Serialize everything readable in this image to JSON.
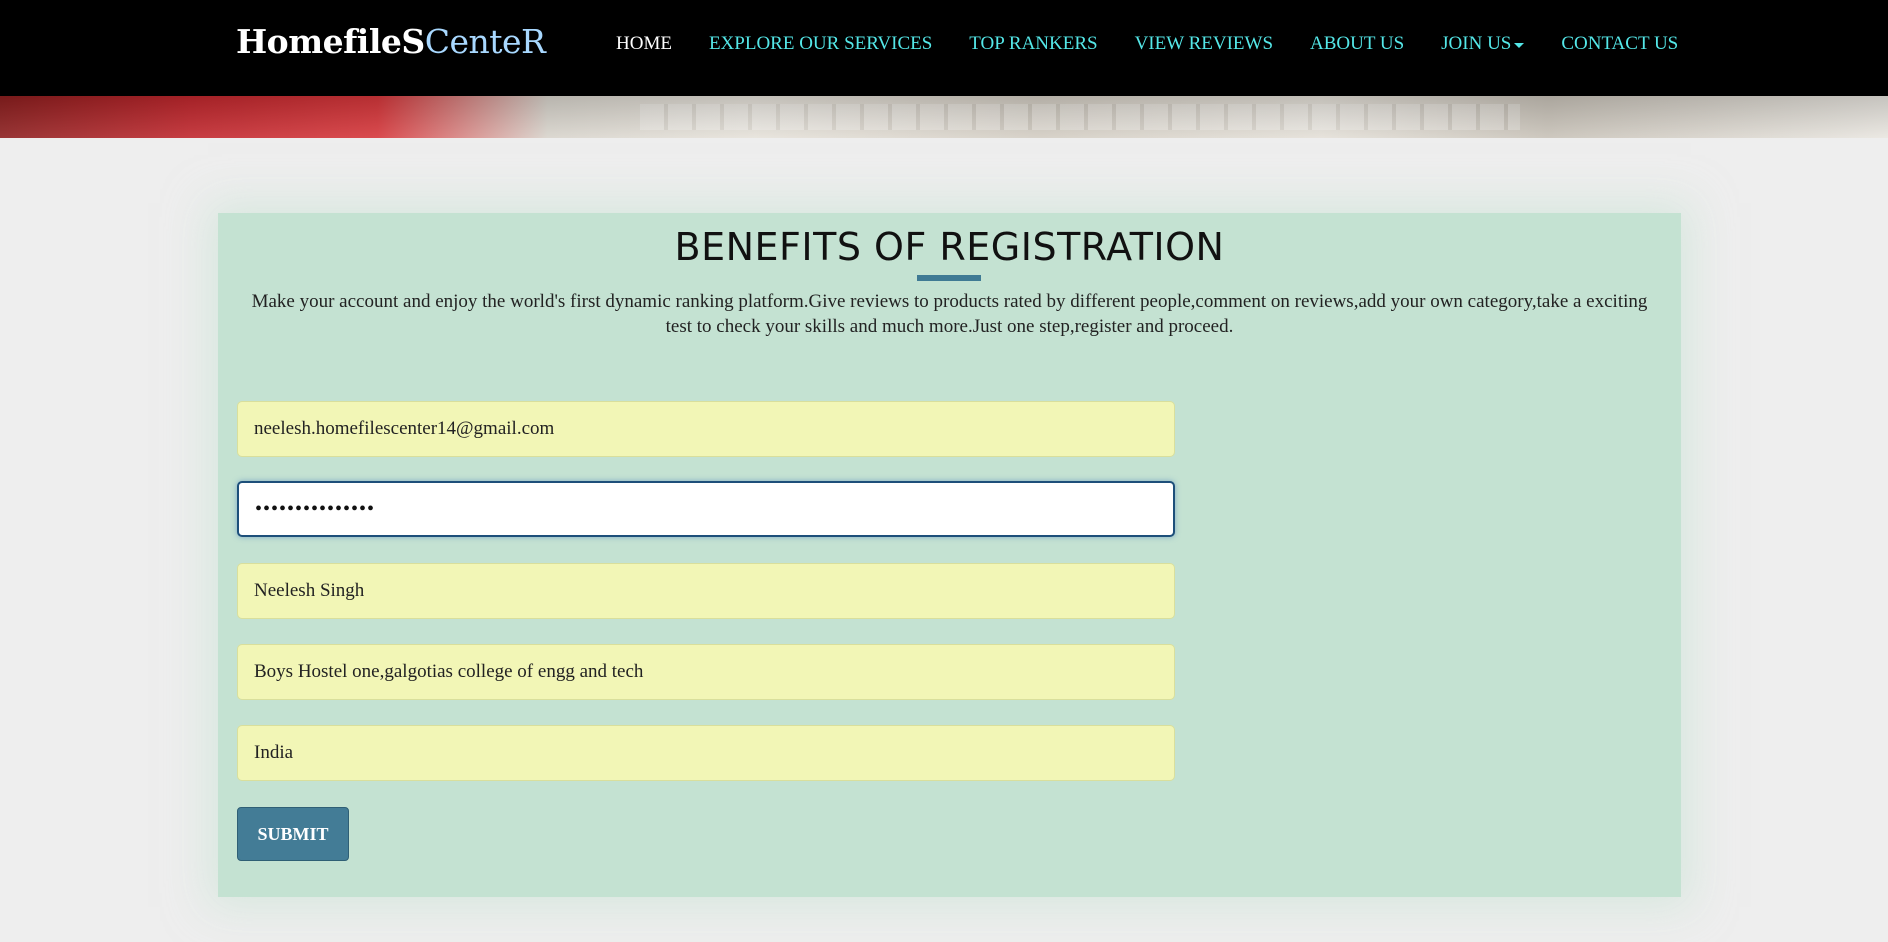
{
  "brand": {
    "part1": "HomefileS",
    "part2": "CenteR"
  },
  "nav": {
    "items": [
      {
        "label": "HOME"
      },
      {
        "label": "EXPLORE OUR SERVICES"
      },
      {
        "label": "TOP RANKERS"
      },
      {
        "label": "VIEW REVIEWS"
      },
      {
        "label": "ABOUT US"
      },
      {
        "label": "JOIN US"
      },
      {
        "label": "CONTACT US"
      }
    ]
  },
  "panel": {
    "title": "BENEFITS OF REGISTRATION",
    "description": "Make your account and enjoy the world's first dynamic ranking platform.Give reviews to products rated by different people,comment on reviews,add your own category,take a exciting test to check your skills and much more.Just one step,register and proceed."
  },
  "form": {
    "email": "neelesh.homefilescenter14@gmail.com",
    "password_masked": "•••••••••••••••",
    "name": "Neelesh Singh",
    "address": "Boys Hostel one,galgotias college of engg and tech",
    "country": "India",
    "submit_label": "SUBMIT"
  },
  "colors": {
    "nav_bg": "#000000",
    "nav_link": "#54e7e8",
    "panel_bg": "#c4e2d2",
    "field_bg": "#f2f6b6",
    "accent": "#437c96"
  }
}
